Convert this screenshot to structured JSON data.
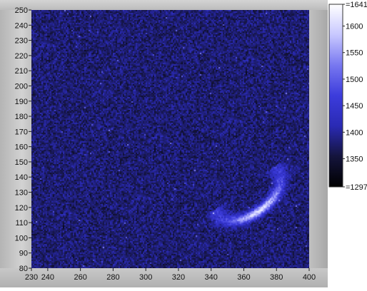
{
  "chart_data": {
    "type": "heatmap",
    "title": "",
    "xlabel": "",
    "ylabel": "",
    "xlim": [
      230,
      400
    ],
    "ylim": [
      80,
      250
    ],
    "x_ticks": [
      230,
      240,
      260,
      280,
      300,
      320,
      340,
      360,
      380,
      400
    ],
    "y_ticks": [
      80,
      90,
      100,
      110,
      120,
      130,
      140,
      150,
      160,
      170,
      180,
      190,
      200,
      210,
      220,
      230,
      240,
      250
    ],
    "x_tick_labels": [
      "230",
      "240",
      "260",
      "280",
      "300",
      "320",
      "340",
      "360",
      "380",
      "400"
    ],
    "y_tick_labels": [
      "80",
      "90",
      "100",
      "110",
      "120",
      "130",
      "140",
      "150",
      "160",
      "170",
      "180",
      "190",
      "200",
      "210",
      "220",
      "230",
      "240",
      "250"
    ],
    "background_level": 1380,
    "feature": {
      "shape": "crescent",
      "center_x": 362,
      "center_y": 130,
      "peak_value": 1600,
      "extent_x": [
        350,
        375
      ],
      "extent_y": [
        110,
        152
      ]
    },
    "colorscale": {
      "min": 1297,
      "max": 1641,
      "stops": [
        "#000000",
        "#14143c",
        "#2a2ab4",
        "#3c3cdc",
        "#7878f0",
        "#c8c8ff",
        "#ffffff"
      ],
      "ticks": [
        1297,
        1350,
        1400,
        1450,
        1500,
        1550,
        1600,
        1641
      ],
      "tick_labels": [
        "1297",
        "1350",
        "1400",
        "1450",
        "1500",
        "1550",
        "1600",
        "1641"
      ]
    },
    "grid": false
  }
}
